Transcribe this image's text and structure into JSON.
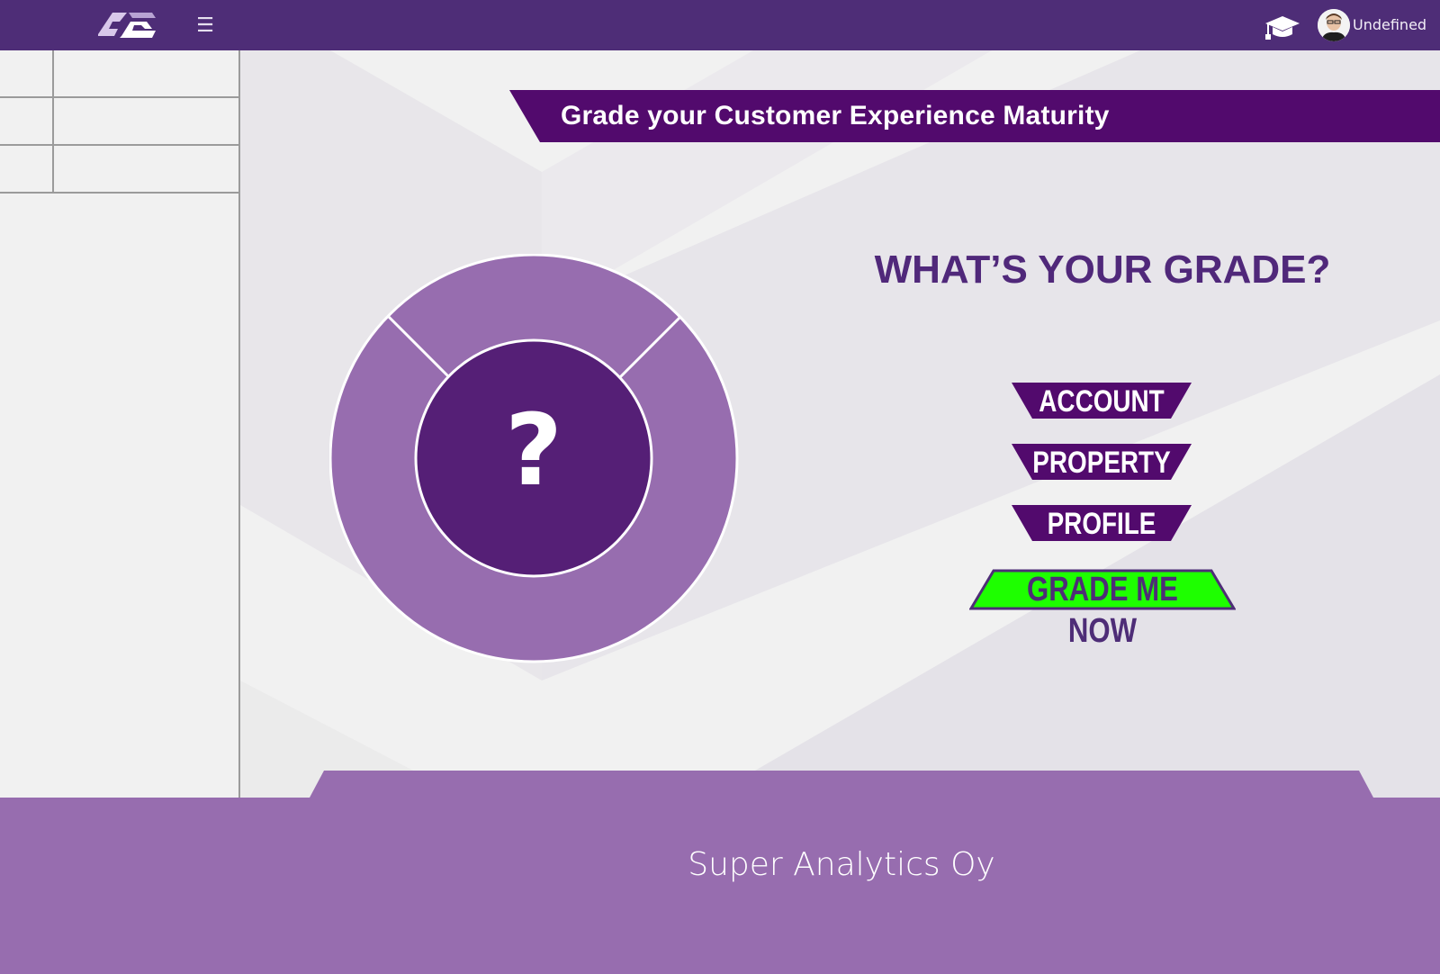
{
  "header": {
    "user_name": "Undefined"
  },
  "sidebar": {
    "items": [
      {
        "label": ""
      },
      {
        "label": ""
      },
      {
        "label": ""
      }
    ]
  },
  "main": {
    "title": "Grade your Customer Experience Maturity",
    "wheel_center": "?",
    "heading": "WHAT’S YOUR GRADE?",
    "buttons": {
      "account": "ACCOUNT",
      "property": "PROPERTY",
      "profile": "PROFILE",
      "grade_me_now": "GRADE ME NOW"
    }
  },
  "footer": {
    "company": "Super Analytics Oy"
  },
  "colors": {
    "brand_purple": "#4e2d77",
    "banner_purple": "#520a6d",
    "light_purple": "#976daf",
    "center_purple": "#551f76",
    "cta_green": "#1eff00"
  },
  "icons": {
    "logo": "company-logo",
    "menu": "hamburger-icon",
    "graduation": "graduation-cap-icon",
    "avatar": "user-avatar"
  }
}
